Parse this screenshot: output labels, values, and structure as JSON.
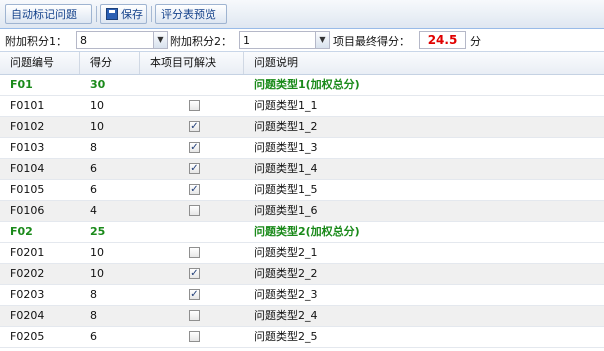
{
  "toolbar": {
    "auto_mark_label": "自动标记问题",
    "save_label": "保存",
    "preview_label": "评分表预览"
  },
  "bonus": {
    "bonus1_label": "附加积分1：",
    "bonus1_value": "8",
    "bonus2_label": "附加积分2：",
    "bonus2_value": "1",
    "final_label": "项目最终得分：",
    "final_value": "24.5",
    "final_unit": "分"
  },
  "grid": {
    "headers": [
      "问题编号",
      "得分",
      "本项目可解决",
      "问题说明"
    ],
    "rows": [
      {
        "id": "F01",
        "score": "30",
        "group": true,
        "desc": "问题类型1(加权总分)"
      },
      {
        "id": "F0101",
        "score": "10",
        "group": false,
        "checked": false,
        "desc": "问题类型1_1"
      },
      {
        "id": "F0102",
        "score": "10",
        "group": false,
        "checked": true,
        "desc": "问题类型1_2"
      },
      {
        "id": "F0103",
        "score": "8",
        "group": false,
        "checked": true,
        "desc": "问题类型1_3"
      },
      {
        "id": "F0104",
        "score": "6",
        "group": false,
        "checked": true,
        "desc": "问题类型1_4"
      },
      {
        "id": "F0105",
        "score": "6",
        "group": false,
        "checked": true,
        "desc": "问题类型1_5"
      },
      {
        "id": "F0106",
        "score": "4",
        "group": false,
        "checked": false,
        "desc": "问题类型1_6"
      },
      {
        "id": "F02",
        "score": "25",
        "group": true,
        "desc": "问题类型2(加权总分)"
      },
      {
        "id": "F0201",
        "score": "10",
        "group": false,
        "checked": false,
        "desc": "问题类型2_1"
      },
      {
        "id": "F0202",
        "score": "10",
        "group": false,
        "checked": true,
        "desc": "问题类型2_2"
      },
      {
        "id": "F0203",
        "score": "8",
        "group": false,
        "checked": true,
        "desc": "问题类型2_3"
      },
      {
        "id": "F0204",
        "score": "8",
        "group": false,
        "checked": false,
        "desc": "问题类型2_4"
      },
      {
        "id": "F0205",
        "score": "6",
        "group": false,
        "checked": false,
        "desc": "问题类型2_5"
      }
    ]
  },
  "colors": {
    "group_text": "#1a8a1a",
    "final_score": "#e00000",
    "alt_row": "#f0f0f0"
  }
}
